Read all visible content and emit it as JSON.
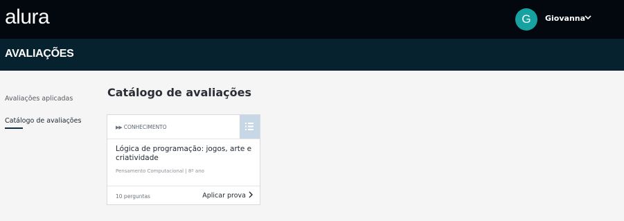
{
  "header": {
    "logo": "alura",
    "user": {
      "initial": "G",
      "name": "Giovanna"
    }
  },
  "subheader": {
    "title": "AVALIAÇÕES"
  },
  "sidebar": {
    "items": [
      {
        "label": "Avaliações aplicadas",
        "active": false
      },
      {
        "label": "Catálogo de avaliações",
        "active": true
      }
    ]
  },
  "main": {
    "title": "Catálogo de avaliações",
    "cards": [
      {
        "tag_icon": "play-forward-icon",
        "tag": "CONHECIMENTO",
        "corner_icon": "list-icon",
        "title": "Lógica de programação: jogos, arte e criatividade",
        "meta": "Pensamento Computacional | 8º ano",
        "questions": "10 perguntas",
        "action": "Aplicar prova"
      }
    ]
  },
  "colors": {
    "topbar": "#03080e",
    "subheader": "#06222f",
    "avatar": "#17a2a2",
    "card_corner": "#c8d7e6",
    "background": "#f5f5f5"
  }
}
